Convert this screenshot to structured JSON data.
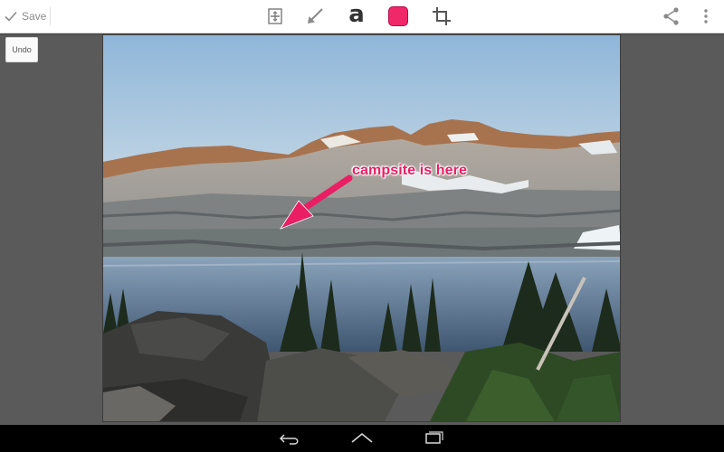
{
  "toolbar": {
    "save_label": "Save",
    "tools": [
      "crop-frame-icon",
      "arrow-tool-icon",
      "text-tool-icon",
      "color-swatch",
      "crop-icon"
    ],
    "text_tool_glyph": "a",
    "active_color": "#f0286a",
    "actions": [
      "share-icon",
      "overflow-menu-icon"
    ]
  },
  "undo_label": "Undo",
  "annotation": {
    "text": "campsite is here",
    "color": "#e91e63"
  },
  "navbar": {
    "buttons": [
      "back-icon",
      "home-icon",
      "recent-apps-icon"
    ]
  }
}
